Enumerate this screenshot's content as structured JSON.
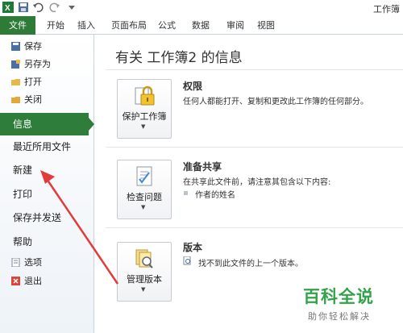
{
  "window": {
    "title": "工作簿"
  },
  "quick_access": {
    "icons": [
      "excel-icon",
      "save-icon",
      "undo-icon",
      "redo-icon",
      "customize-icon"
    ]
  },
  "ribbon": {
    "file_tab": "文件",
    "tabs": [
      "开始",
      "插入",
      "页面布局",
      "公式",
      "数据",
      "审阅",
      "视图"
    ]
  },
  "backstage": {
    "nav_small_top": [
      {
        "label": "保存",
        "icon": "save-icon"
      },
      {
        "label": "另存为",
        "icon": "save-as-icon"
      },
      {
        "label": "打开",
        "icon": "open-folder-icon"
      },
      {
        "label": "关闭",
        "icon": "close-folder-icon"
      }
    ],
    "nav_active": "信息",
    "nav_big": [
      "最近所用文件",
      "新建",
      "打印",
      "保存并发送",
      "帮助"
    ],
    "nav_small_bottom": [
      {
        "label": "选项",
        "icon": "options-icon"
      },
      {
        "label": "退出",
        "icon": "exit-icon"
      }
    ]
  },
  "info": {
    "title": "有关 工作簿2 的信息",
    "sections": [
      {
        "button": "保护工作簿",
        "icon": "lock-icon",
        "heading": "权限",
        "desc": "任何人都能打开、复制和更改此工作簿的任何部分。"
      },
      {
        "button": "检查问题",
        "icon": "inspect-icon",
        "heading": "准备共享",
        "desc": "在共享此文件前，请注意其包含以下内容:",
        "bullet": "作者的姓名"
      },
      {
        "button": "管理版本",
        "icon": "versions-icon",
        "heading": "版本",
        "desc": "找不到此文件的上一个版本。"
      }
    ]
  },
  "watermark": {
    "line1": "百科全说",
    "line2": "助你轻松解决"
  },
  "colors": {
    "accent_green": "#2f7d3a",
    "annotation_red": "#e23b3b",
    "watermark_green": "#33a24a"
  }
}
